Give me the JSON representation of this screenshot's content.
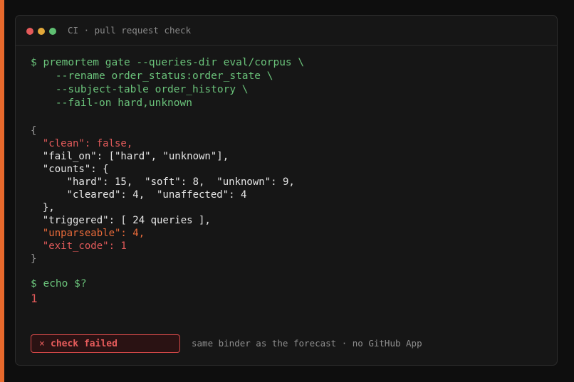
{
  "window": {
    "title": "CI · pull request check"
  },
  "command": {
    "lines": [
      "$ premortem gate --queries-dir eval/corpus \\",
      "    --rename order_status:order_state \\",
      "    --subject-table order_history \\",
      "    --fail-on hard,unknown"
    ]
  },
  "output": {
    "open": "{",
    "clean": "  \"clean\": false,",
    "fail_on": "  \"fail_on\": [\"hard\", \"unknown\"],",
    "counts_open": "  \"counts\": {",
    "counts_line1": "      \"hard\": 15,  \"soft\": 8,  \"unknown\": 9,",
    "counts_line2": "      \"cleared\": 4,  \"unaffected\": 4",
    "counts_close": "  },",
    "triggered": "  \"triggered\": [ 24 queries ],",
    "unparseable": "  \"unparseable\": 4,",
    "exit_code": "  \"exit_code\": 1",
    "close": "}"
  },
  "echo": {
    "command": "$ echo $?",
    "result": "1"
  },
  "status": {
    "icon": "x-icon",
    "icon_glyph": "×",
    "label": "check failed",
    "color": "#e25a5a"
  },
  "footnote": "same binder as the forecast · no GitHub App",
  "colors": {
    "accent": "#e8692c",
    "command": "#6ac27a",
    "error": "#e25a5a",
    "warning": "#e86a3a"
  }
}
